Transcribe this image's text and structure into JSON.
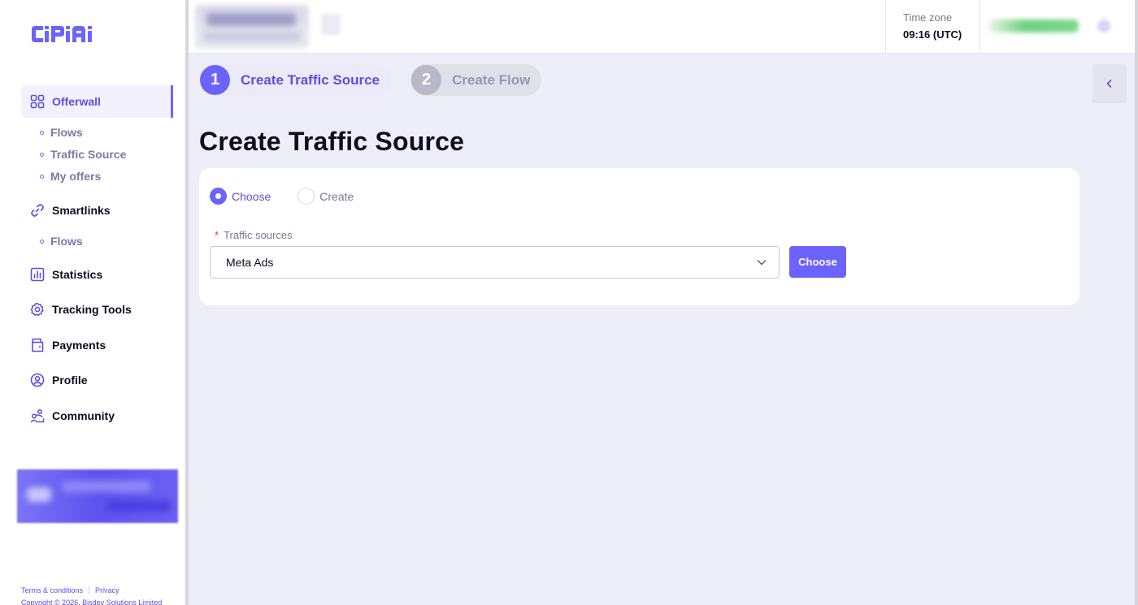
{
  "brand": {
    "logo_text": "CIPIAI",
    "accent": "#6c63ff"
  },
  "sidebar": {
    "items": [
      {
        "label": "Offerwall",
        "icon": "grid-icon",
        "active": true,
        "sub": [
          "Flows",
          "Traffic Source",
          "My offers"
        ]
      },
      {
        "label": "Smartlinks",
        "icon": "link-icon",
        "sub": [
          "Flows"
        ]
      },
      {
        "label": "Statistics",
        "icon": "chart-icon"
      },
      {
        "label": "Tracking Tools",
        "icon": "gear-icon"
      },
      {
        "label": "Payments",
        "icon": "wallet-icon"
      },
      {
        "label": "Profile",
        "icon": "user-icon"
      },
      {
        "label": "Community",
        "icon": "community-icon"
      }
    ],
    "footer": {
      "terms": "Terms & conditions",
      "privacy": "Privacy",
      "copyright": "Copyright © 2026. Bisdev Solutions Limited"
    }
  },
  "topbar": {
    "timezone_label": "Time zone",
    "timezone_value": "09:16 (UTC)"
  },
  "steps": [
    {
      "number": "1",
      "label": "Create Traffic Source",
      "active": true
    },
    {
      "number": "2",
      "label": "Create Flow",
      "active": false
    }
  ],
  "main": {
    "title": "Create Traffic Source",
    "radio_options": [
      {
        "label": "Choose",
        "checked": true
      },
      {
        "label": "Create",
        "checked": false
      }
    ],
    "field_label": "Traffic sources",
    "field_required": "*",
    "select_value": "Meta Ads",
    "choose_button": "Choose"
  }
}
